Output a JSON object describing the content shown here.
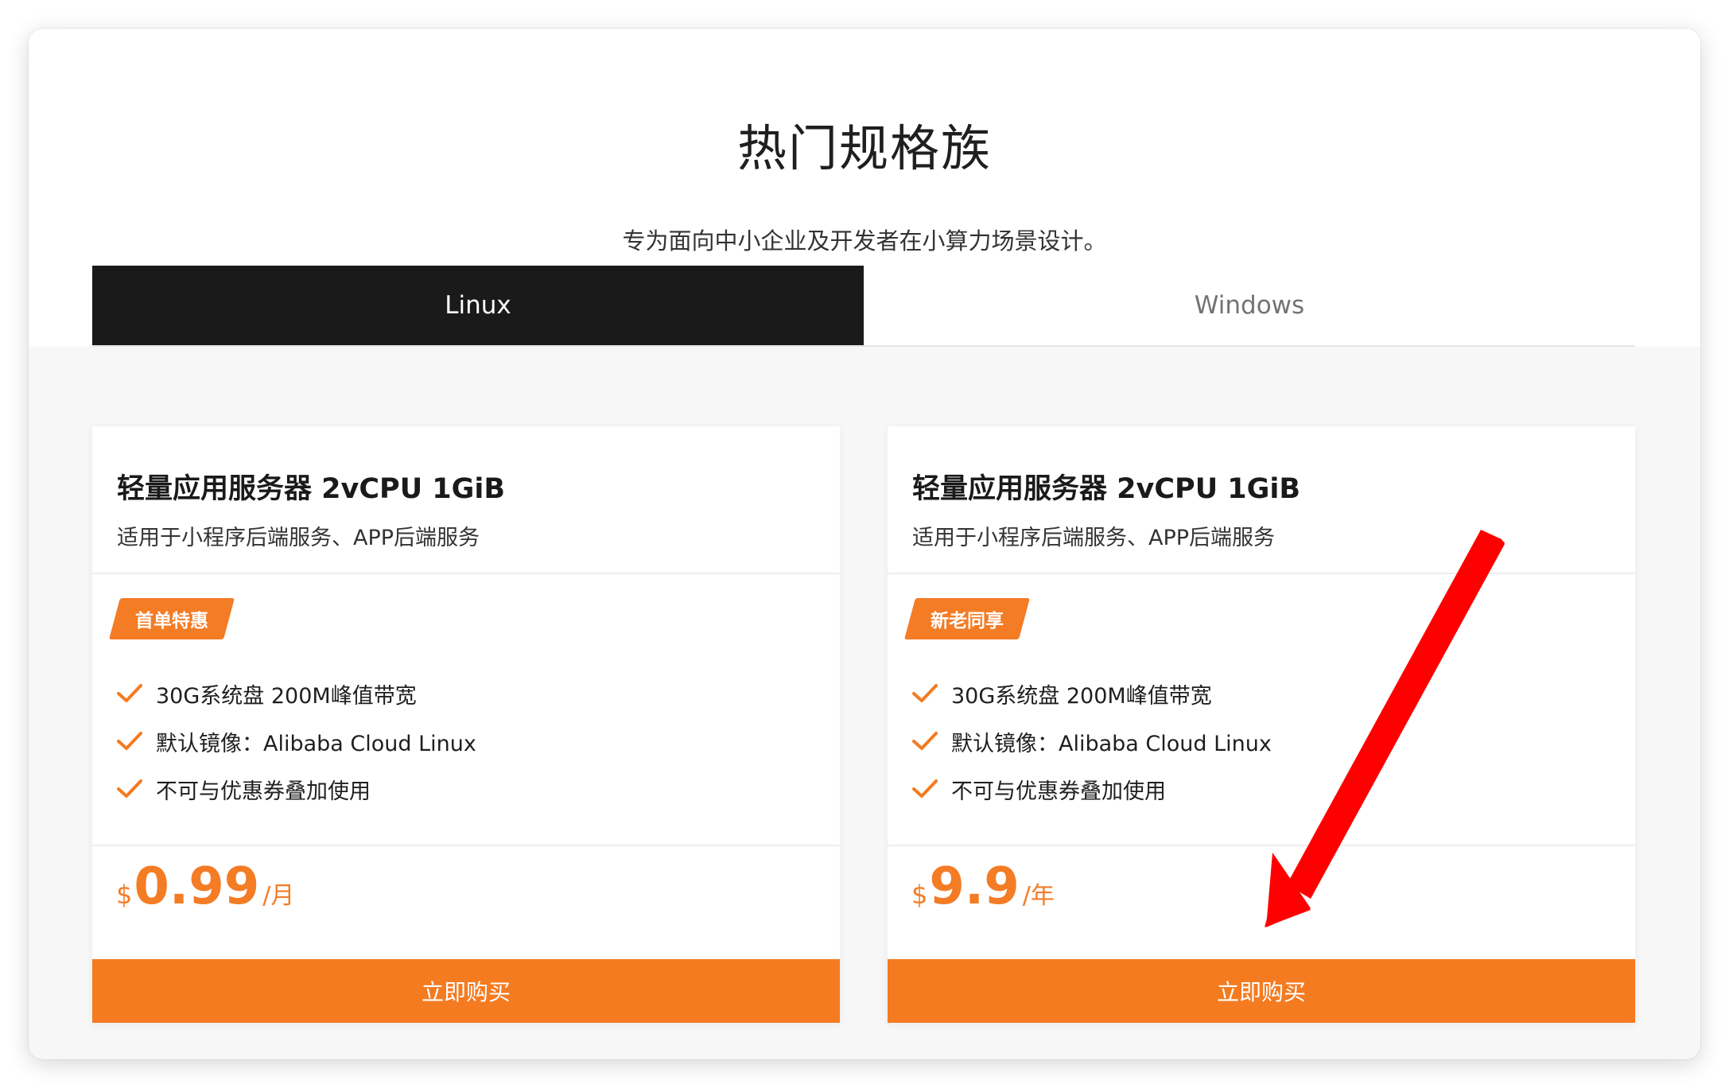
{
  "header": {
    "title": "热门规格族",
    "subtitle": "专为面向中小企业及开发者在小算力场景设计。"
  },
  "tabs": [
    {
      "label": "Linux",
      "active": true
    },
    {
      "label": "Windows",
      "active": false
    }
  ],
  "cards": [
    {
      "title": "轻量应用服务器 2vCPU 1GiB",
      "description": "适用于小程序后端服务、APP后端服务",
      "badge": "首单特惠",
      "features": [
        "30G系统盘 200M峰值带宽",
        "默认镜像：Alibaba Cloud Linux",
        "不可与优惠券叠加使用"
      ],
      "price": {
        "currency": "$",
        "amount": "0.99",
        "unit": "/月"
      },
      "button_label": "立即购买"
    },
    {
      "title": "轻量应用服务器 2vCPU 1GiB",
      "description": "适用于小程序后端服务、APP后端服务",
      "badge": "新老同享",
      "features": [
        "30G系统盘 200M峰值带宽",
        "默认镜像：Alibaba Cloud Linux",
        "不可与优惠券叠加使用"
      ],
      "price": {
        "currency": "$",
        "amount": "9.9",
        "unit": "/年"
      },
      "button_label": "立即购买"
    }
  ],
  "colors": {
    "accent": "#f47b20",
    "tab_active_bg": "#1a1a1a",
    "annotation_arrow": "#ff0000"
  },
  "icons": {
    "feature_bullet": "check-icon",
    "annotation": "red-arrow-icon"
  }
}
